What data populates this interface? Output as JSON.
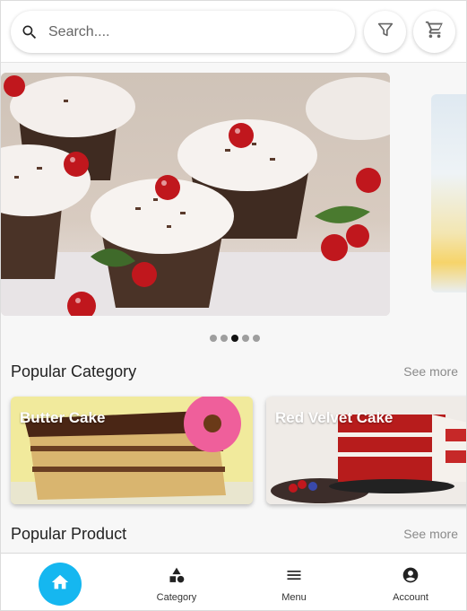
{
  "search": {
    "placeholder": "Search...."
  },
  "icons": {
    "search": "search-icon",
    "filter": "filter-icon",
    "cart": "cart-icon",
    "home": "home-icon",
    "category": "category-icon",
    "menu": "menu-icon",
    "account": "account-icon"
  },
  "carousel": {
    "slide_count": 5,
    "active_index": 2
  },
  "popular_category": {
    "title": "Popular Category",
    "see_more": "See more",
    "items": [
      {
        "label": "Butter Cake"
      },
      {
        "label": "Red Velvet Cake"
      }
    ]
  },
  "popular_product": {
    "title": "Popular Product",
    "see_more": "See more"
  },
  "bottom_nav": {
    "category": "Category",
    "menu": "Menu",
    "account": "Account"
  },
  "colors": {
    "accent": "#15b7f0",
    "dot_active": "#111111",
    "dot_inactive": "#9e9e9e"
  }
}
